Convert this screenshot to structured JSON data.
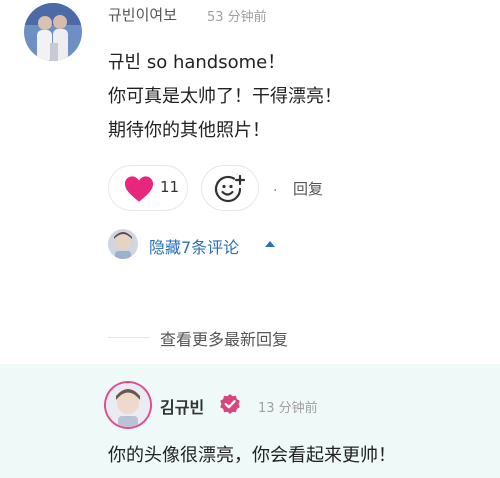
{
  "comment": {
    "author": "규빈이여보",
    "time": "53 分钟前",
    "lines": [
      "규빈 so handsome！",
      "你可真是太帅了！干得漂亮！",
      "期待你的其他照片！"
    ],
    "like_count": "11",
    "separator": "·",
    "reply_label": "回复",
    "hide_replies_label": "隐藏7条评论"
  },
  "more_replies_label": "查看更多最新回复",
  "reply": {
    "author": "김규빈",
    "time": "13 分钟前",
    "text": "你的头像很漂亮，你会看起来更帅！"
  },
  "colors": {
    "heart": "#e8267c",
    "link": "#2a6fb8",
    "verified": "#d9457e",
    "reply_highlight": "#eef9f8",
    "avatar_ring": "#e24b8c"
  },
  "icons": {
    "like": "heart-icon",
    "emoji": "add-emoji-icon",
    "collapse": "caret-up-icon",
    "verified": "verified-badge-icon"
  }
}
